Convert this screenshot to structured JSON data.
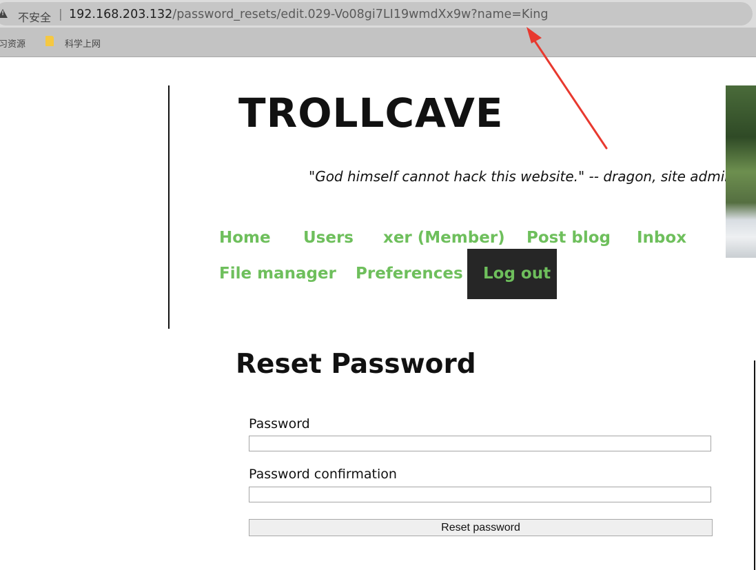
{
  "browser": {
    "security_label": "不安全",
    "separator": "|",
    "url_host": "192.168.203.132",
    "url_rest": "/password_resets/edit.029-Vo08gi7LI19wmdXx9w?name=King",
    "bookmarks": [
      "习资源",
      "科学上网"
    ]
  },
  "site": {
    "title": "TROLLCAVE",
    "tagline": "\"God himself cannot hack this website.\" -- dragon, site admin"
  },
  "nav": {
    "items": [
      "Home",
      "Users",
      "xer (Member)",
      "Post blog",
      "Inbox",
      "File manager",
      "Preferences",
      "Log out"
    ],
    "accent_color": "#6ebf5c"
  },
  "form": {
    "heading": "Reset Password",
    "password_label": "Password",
    "password_value": "",
    "confirmation_label": "Password confirmation",
    "confirmation_value": "",
    "submit_label": "Reset password"
  },
  "annotation": {
    "arrow_color": "#e8392f"
  },
  "icons": [
    "warning-icon",
    "folder-icon"
  ]
}
